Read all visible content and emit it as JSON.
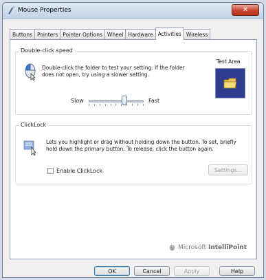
{
  "window": {
    "title": "Mouse Properties",
    "close_label": "✕"
  },
  "tabs": [
    {
      "label": "Buttons",
      "active": false
    },
    {
      "label": "Pointers",
      "active": false
    },
    {
      "label": "Pointer Options",
      "active": false
    },
    {
      "label": "Wheel",
      "active": false
    },
    {
      "label": "Hardware",
      "active": false
    },
    {
      "label": "Activities",
      "active": true
    },
    {
      "label": "Wireless",
      "active": false
    }
  ],
  "double_click": {
    "group_label": "Double-click speed",
    "description_line1": "Double-click the folder to test your setting. If the folder",
    "description_line2": "does not open, try using a slower setting.",
    "test_area_label": "Test Area",
    "slow_label": "Slow",
    "fast_label": "Fast",
    "speed_fraction": 0.65
  },
  "clicklock": {
    "group_label": "ClickLock",
    "description_line1": "Lets you highlight or drag without holding down the button. To set, briefly",
    "description_line2": "hold down the primary button. To release, click the button again.",
    "enable_label": "Enable ClickLock",
    "enabled": false,
    "settings_label": "Settings..."
  },
  "brand": {
    "prefix": "Microsoft",
    "product": "IntelliPoint"
  },
  "footer": {
    "ok_label": "OK",
    "cancel_label": "Cancel",
    "apply_label": "Apply",
    "help_label": "Help"
  }
}
